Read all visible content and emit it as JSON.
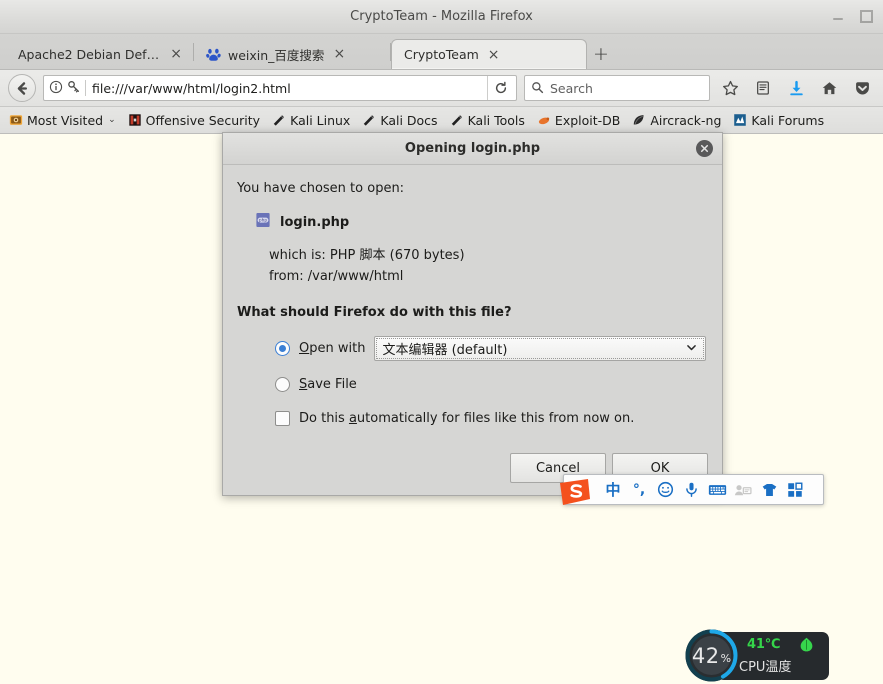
{
  "window": {
    "title": "CryptoTeam - Mozilla Firefox",
    "minimize_label": "Minimize",
    "maximize_label": "Maximize"
  },
  "tabs": [
    {
      "label": "Apache2 Debian Default ...",
      "favicon": "none",
      "close_label": "×",
      "active": false
    },
    {
      "label": "weixin_百度搜索",
      "favicon": "baidu-paw-icon",
      "close_label": "×",
      "active": false
    },
    {
      "label": "CryptoTeam",
      "favicon": "none",
      "close_label": "×",
      "active": true
    }
  ],
  "newtab": {
    "label": "+"
  },
  "navbar": {
    "back_icon": "back-arrow-icon",
    "info_icon": "info-circle-icon",
    "key_icon": "key-icon",
    "url": "file:///var/www/html/login2.html",
    "reload_icon": "reload-icon",
    "search": {
      "placeholder": "Search",
      "icon": "search-icon"
    },
    "icons": [
      {
        "name": "bookmark-star-icon",
        "glyph": "☆"
      },
      {
        "name": "library-icon",
        "glyph": "▤"
      },
      {
        "name": "downloads-icon",
        "glyph": "↓"
      },
      {
        "name": "home-icon",
        "glyph": "⌂"
      },
      {
        "name": "pocket-icon",
        "glyph": "▼"
      }
    ]
  },
  "bookmarks": [
    {
      "label": "Most Visited",
      "icon": "most-visited-icon",
      "caret": "⌄"
    },
    {
      "label": "Offensive Security",
      "icon": "offensive-security-icon"
    },
    {
      "label": "Kali Linux",
      "icon": "kali-dragon-icon"
    },
    {
      "label": "Kali Docs",
      "icon": "kali-dragon-icon"
    },
    {
      "label": "Kali Tools",
      "icon": "kali-dragon-icon"
    },
    {
      "label": "Exploit-DB",
      "icon": "exploit-db-icon"
    },
    {
      "label": "Aircrack-ng",
      "icon": "aircrack-ng-icon"
    },
    {
      "label": "Kali Forums",
      "icon": "kali-forums-icon"
    }
  ],
  "dialog": {
    "title": "Opening login.php",
    "close_icon": "close-icon",
    "chosen_text": "You have chosen to open:",
    "file": {
      "icon": "php-file-icon",
      "name": "login.php",
      "which_is": "which is: PHP 脚本 (670 bytes)",
      "from": "from: /var/www/html"
    },
    "question": "What should Firefox do with this file?",
    "open_with": {
      "label_pre": "",
      "accel": "O",
      "label_post": "pen with",
      "selected": true,
      "select_value": "文本编辑器 (default)",
      "caret_icon": "chevron-down-icon"
    },
    "save_file": {
      "label_pre": "",
      "accel": "S",
      "label_post": "ave File",
      "selected": false
    },
    "remember": {
      "label_pre": "Do this ",
      "accel": "a",
      "label_post": "utomatically for files like this from now on.",
      "checked": false
    },
    "buttons": {
      "cancel": "Cancel",
      "ok": "OK"
    }
  },
  "ime": {
    "logo_icon": "sogou-logo-icon",
    "items": [
      {
        "name": "chinese-mode-icon",
        "glyph": "中"
      },
      {
        "name": "punctuation-mode-icon",
        "glyph": "°,"
      },
      {
        "name": "emoji-icon",
        "glyph": "☺"
      },
      {
        "name": "voice-input-icon",
        "glyph": "mic"
      },
      {
        "name": "soft-keyboard-icon",
        "glyph": "kbd"
      },
      {
        "name": "user-card-icon",
        "glyph": "card"
      },
      {
        "name": "skin-icon",
        "glyph": "shirt"
      },
      {
        "name": "apps-grid-icon",
        "glyph": "grid"
      }
    ]
  },
  "cpu_widget": {
    "percent": "42",
    "percent_unit": "%",
    "temperature": "41℃",
    "label": "CPU温度",
    "leaf_icon": "leaf-icon",
    "ring_color": "#1fa8e8",
    "temp_color": "#35d64a"
  }
}
